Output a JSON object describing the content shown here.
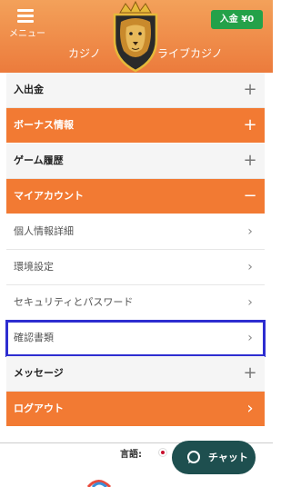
{
  "header": {
    "menu_label": "メニュー",
    "deposit_label": "入金 ¥0",
    "tabs": [
      "カジノ",
      "ライブカジノ"
    ]
  },
  "menu": [
    {
      "label": "入出金",
      "style": "head",
      "icon": "plus-icon",
      "symbol": "+"
    },
    {
      "label": "ボーナス情報",
      "style": "orange",
      "icon": "plus-icon",
      "symbol": "+"
    },
    {
      "label": "ゲーム履歴",
      "style": "head",
      "icon": "plus-icon",
      "symbol": "+"
    },
    {
      "label": "マイアカウント",
      "style": "orange",
      "icon": "minus-icon",
      "symbol": "−"
    },
    {
      "label": "個人情報詳細",
      "style": "sub",
      "icon": "chevron-right-icon",
      "symbol": "›"
    },
    {
      "label": "環境設定",
      "style": "sub",
      "icon": "chevron-right-icon",
      "symbol": "›"
    },
    {
      "label": "セキュリティとパスワード",
      "style": "sub",
      "icon": "chevron-right-icon",
      "symbol": "›"
    },
    {
      "label": "確認書類",
      "style": "sub",
      "icon": "chevron-right-icon",
      "symbol": "›",
      "selected": true
    },
    {
      "label": "メッセージ",
      "style": "head",
      "icon": "plus-icon",
      "symbol": "+"
    },
    {
      "label": "ログアウト",
      "style": "orange",
      "icon": "chevron-right-icon",
      "symbol": "›"
    }
  ],
  "footer": {
    "language_label": "言語:",
    "chat_label": "チャット"
  },
  "colors": {
    "accent_orange": "#f27a33",
    "deposit_green": "#24a149",
    "chat_teal": "#1e4f4f",
    "selection_blue": "#2d2dd0"
  }
}
